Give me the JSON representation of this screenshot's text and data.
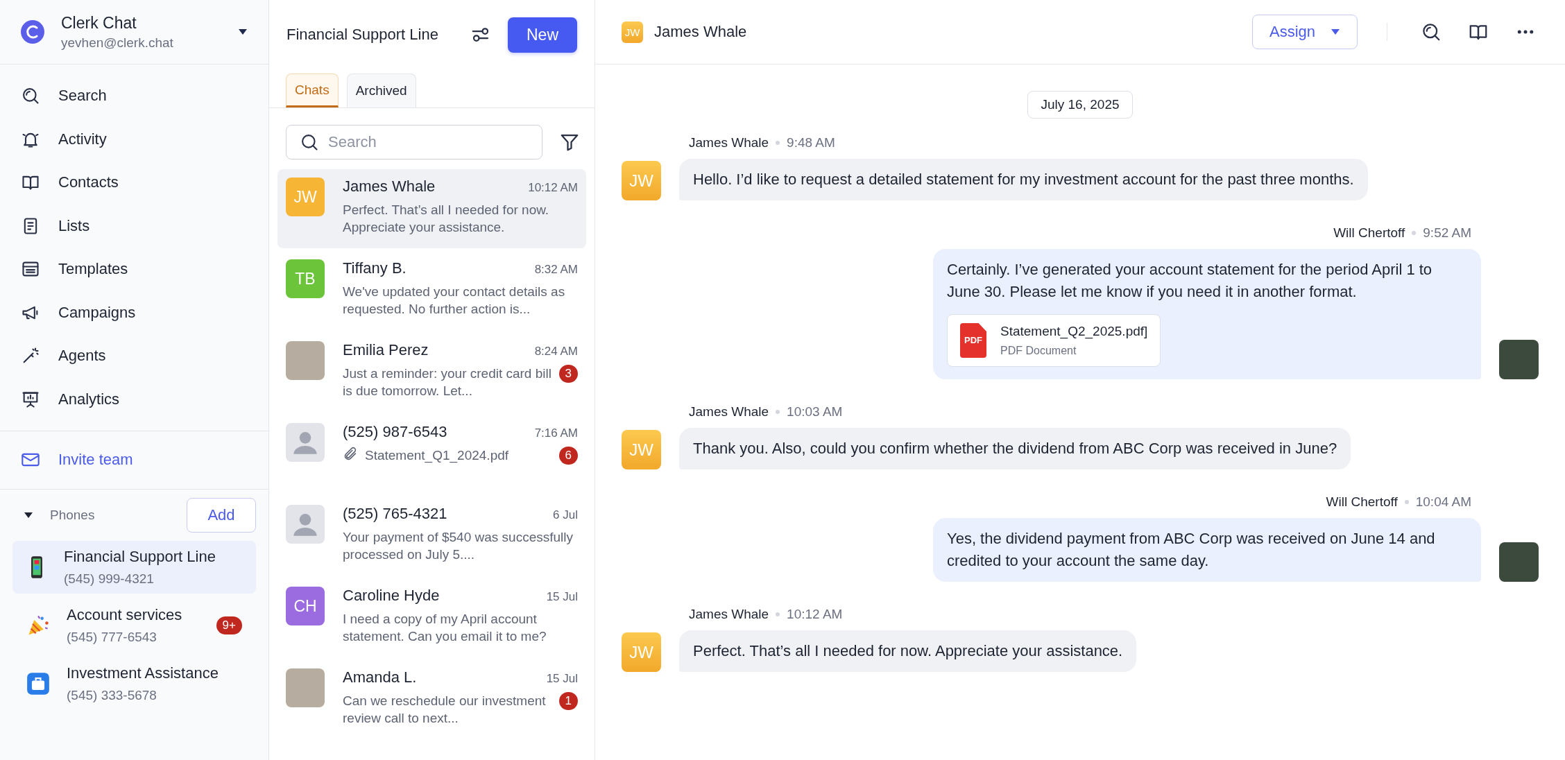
{
  "workspace": {
    "name": "Clerk Chat",
    "email": "yevhen@clerk.chat"
  },
  "nav": [
    {
      "label": "Search",
      "kind": "search"
    },
    {
      "label": "Activity",
      "kind": "bell"
    },
    {
      "label": "Contacts",
      "kind": "book"
    },
    {
      "label": "Lists",
      "kind": "list"
    },
    {
      "label": "Templates",
      "kind": "template"
    },
    {
      "label": "Campaigns",
      "kind": "megaphone"
    },
    {
      "label": "Agents",
      "kind": "wand"
    },
    {
      "label": "Analytics",
      "kind": "presentation"
    }
  ],
  "invite": {
    "label": "Invite team"
  },
  "phones": {
    "label": "Phones",
    "add_label": "Add",
    "items": [
      {
        "name": "Financial Support Line",
        "number": "(545) 999-4321",
        "kind": "phone",
        "selected": true
      },
      {
        "name": "Account services",
        "number": "(545) 777-6543",
        "kind": "party",
        "selected": false,
        "badge": "9+"
      },
      {
        "name": "Investment Assistance",
        "number": "(545) 333-5678",
        "kind": "luggage",
        "selected": false
      }
    ]
  },
  "inbox": {
    "title": "Financial Support Line",
    "new_label": "New",
    "tabs": [
      {
        "label": "Chats",
        "selected": true
      },
      {
        "label": "Archived",
        "selected": false
      }
    ],
    "search": {
      "placeholder": "Search"
    },
    "chats": [
      {
        "name": "James Whale",
        "time": "10:12 AM",
        "preview": "Perfect. That’s all I needed for now. Appreciate your assistance.",
        "avatar": {
          "kind": "initials",
          "text": "JW",
          "color": "#f6b535"
        },
        "selected": true,
        "attachment": false
      },
      {
        "name": "Tiffany B.",
        "time": "8:32 AM",
        "preview": "We've updated your contact details as requested. No further action is...",
        "avatar": {
          "kind": "initials",
          "text": "TB",
          "color": "#6cc43a"
        },
        "selected": false,
        "attachment": false
      },
      {
        "name": "Emilia Perez",
        "time": "8:24 AM",
        "preview": "Just a reminder: your credit card bill is due tomorrow. Let...",
        "avatar": {
          "kind": "photo"
        },
        "selected": false,
        "attachment": false,
        "badge": "3"
      },
      {
        "name": "(525) 987-6543",
        "time": "7:16 AM",
        "preview": "Statement_Q1_2024.pdf",
        "avatar": {
          "kind": "unknown"
        },
        "selected": false,
        "attachment": true,
        "badge": "6"
      },
      {
        "name": "(525) 765-4321",
        "time": "6 Jul",
        "preview": "Your payment of $540 was successfully processed on July 5....",
        "avatar": {
          "kind": "unknown"
        },
        "selected": false,
        "attachment": false
      },
      {
        "name": "Caroline Hyde",
        "time": "15 Jul",
        "preview": "I need a copy of my April account statement. Can you email it to me?",
        "avatar": {
          "kind": "initials",
          "text": "CH",
          "color": "#9b6be0"
        },
        "selected": false,
        "attachment": false
      },
      {
        "name": "Amanda L.",
        "time": "15 Jul",
        "preview": "Can we reschedule our investment review call to next...",
        "avatar": {
          "kind": "photo"
        },
        "selected": false,
        "attachment": false,
        "badge": "1"
      }
    ]
  },
  "conversation": {
    "contact": {
      "name": "James Whale",
      "initials": "JW"
    },
    "assign_label": "Assign",
    "date": "July 16, 2025",
    "messages": [
      {
        "kind": "incoming",
        "sender": "James Whale",
        "time": "9:48 AM",
        "avatar": "JW",
        "text": "Hello. I’d like to request a detailed statement for my investment account for the past three months."
      },
      {
        "kind": "outgoing",
        "sender": "Will Chertoff",
        "time": "9:52 AM",
        "text": "Certainly. I’ve generated your account statement for the period April 1 to June 30. Please let me know if you need it in another format.",
        "file": {
          "name": "Statement_Q2_2025.pdf]",
          "type": "PDF Document",
          "badge": "PDF"
        }
      },
      {
        "kind": "incoming",
        "sender": "James Whale",
        "time": "10:03 AM",
        "avatar": "JW",
        "text": "Thank you. Also, could you confirm whether the dividend from ABC Corp was received in June?"
      },
      {
        "kind": "outgoing",
        "sender": "Will Chertoff",
        "time": "10:04 AM",
        "text": "Yes, the dividend payment from ABC Corp was received on June 14 and credited to your account the same day."
      },
      {
        "kind": "incoming",
        "sender": "James Whale",
        "time": "10:12 AM",
        "avatar": "JW",
        "text": "Perfect. That’s all I needed for now. Appreciate your assistance."
      }
    ]
  }
}
